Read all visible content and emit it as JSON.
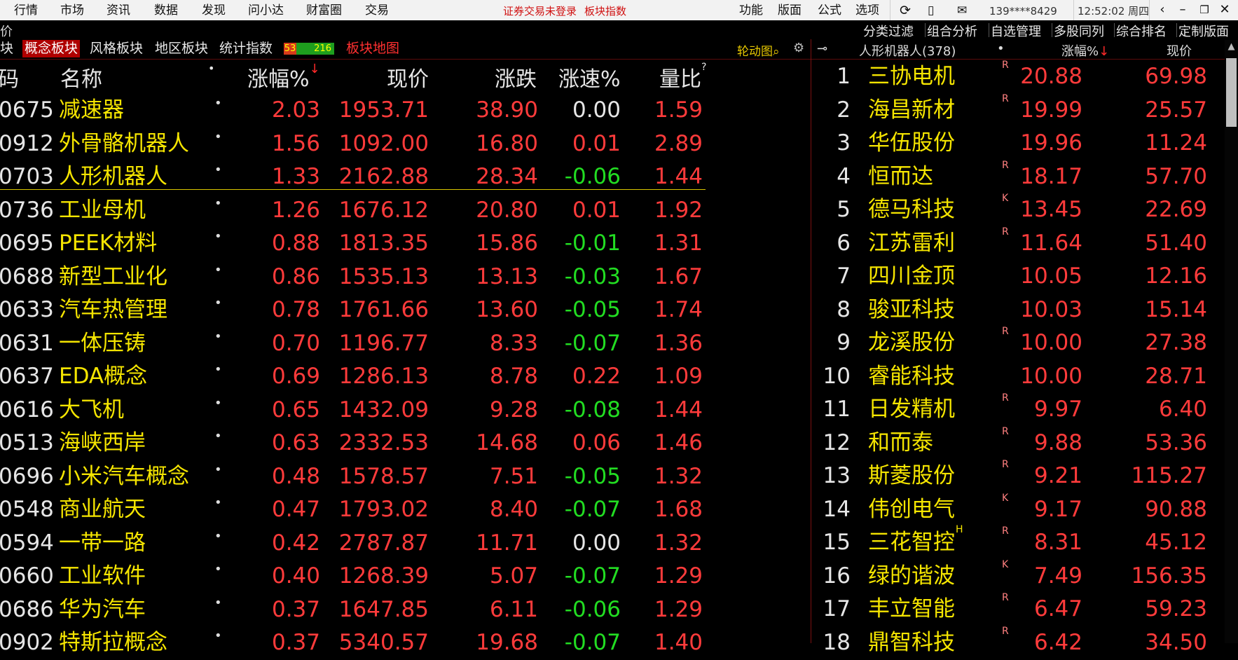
{
  "menu": {
    "items": [
      "行情",
      "市场",
      "资讯",
      "数据",
      "发现",
      "问小达",
      "财富圈",
      "交易"
    ],
    "notice_login": "证券交易未登录",
    "notice_index": "板块指数",
    "right_items": [
      "功能",
      "版面",
      "公式",
      "选项"
    ],
    "account": "139****8429",
    "clock": "12:52:02 周四"
  },
  "toolbar": {
    "left_label": "价",
    "tools": [
      "分类过滤",
      "组合分析",
      "自选管理",
      "多股同列",
      "综合排名",
      "定制版面"
    ]
  },
  "tabs": {
    "cut_tab": "块",
    "items": [
      "概念板块",
      "风格板块",
      "地区板块",
      "统计指数"
    ],
    "up_count": "53",
    "down_count": "216",
    "map_label": "板块地图",
    "rotate_label": "轮动图"
  },
  "right_panel": {
    "title": "人形机器人(378)",
    "dot": "•",
    "col_pct": "涨幅%",
    "col_price": "现价",
    "stocks": [
      {
        "rank": "1",
        "name": "三协电机",
        "tag": "R",
        "pct": "20.88",
        "price": "69.98"
      },
      {
        "rank": "2",
        "name": "海昌新材",
        "tag": "R",
        "pct": "19.99",
        "price": "25.57"
      },
      {
        "rank": "3",
        "name": "华伍股份",
        "tag": "",
        "pct": "19.96",
        "price": "11.24"
      },
      {
        "rank": "4",
        "name": "恒而达",
        "tag": "R",
        "pct": "18.17",
        "price": "57.70"
      },
      {
        "rank": "5",
        "name": "德马科技",
        "tag": "K",
        "pct": "13.45",
        "price": "22.69"
      },
      {
        "rank": "6",
        "name": "江苏雷利",
        "tag": "R",
        "pct": "11.64",
        "price": "51.40"
      },
      {
        "rank": "7",
        "name": "四川金顶",
        "tag": "",
        "pct": "10.05",
        "price": "12.16"
      },
      {
        "rank": "8",
        "name": "骏亚科技",
        "tag": "",
        "pct": "10.03",
        "price": "15.14"
      },
      {
        "rank": "9",
        "name": "龙溪股份",
        "tag": "R",
        "pct": "10.00",
        "price": "27.38"
      },
      {
        "rank": "10",
        "name": "睿能科技",
        "tag": "",
        "pct": "10.00",
        "price": "28.71"
      },
      {
        "rank": "11",
        "name": "日发精机",
        "tag": "R",
        "pct": "9.97",
        "price": "6.40"
      },
      {
        "rank": "12",
        "name": "和而泰",
        "tag": "R",
        "pct": "9.88",
        "price": "53.36"
      },
      {
        "rank": "13",
        "name": "斯菱股份",
        "tag": "R",
        "pct": "9.21",
        "price": "115.27"
      },
      {
        "rank": "14",
        "name": "伟创电气",
        "tag": "K",
        "pct": "9.17",
        "price": "90.88"
      },
      {
        "rank": "15",
        "name": "三花智控",
        "tag": "R",
        "pct": "8.31",
        "price": "45.12",
        "sup": "H"
      },
      {
        "rank": "16",
        "name": "绿的谐波",
        "tag": "K",
        "pct": "7.49",
        "price": "156.35"
      },
      {
        "rank": "17",
        "name": "丰立智能",
        "tag": "R",
        "pct": "6.47",
        "price": "59.23"
      },
      {
        "rank": "18",
        "name": "鼎智科技",
        "tag": "R",
        "pct": "6.42",
        "price": "34.50"
      }
    ]
  },
  "table": {
    "headers": {
      "code": "码",
      "name": "名称",
      "dot": "•",
      "pct": "涨幅%",
      "price": "现价",
      "change": "涨跌",
      "speed": "涨速%",
      "vol_ratio": "量比",
      "vol_sup": "?"
    },
    "rows": [
      {
        "code": "0675",
        "name": "减速器",
        "pct": "2.03",
        "price": "1953.71",
        "change": "38.90",
        "speed": "0.00",
        "speed_dir": "flat",
        "vr": "1.59"
      },
      {
        "code": "0912",
        "name": "外骨骼机器人",
        "pct": "1.56",
        "price": "1092.00",
        "change": "16.80",
        "speed": "0.01",
        "speed_dir": "up",
        "vr": "2.89"
      },
      {
        "code": "0703",
        "name": "人形机器人",
        "pct": "1.33",
        "price": "2162.88",
        "change": "28.34",
        "speed": "-0.06",
        "speed_dir": "down",
        "vr": "1.44"
      },
      {
        "code": "0736",
        "name": "工业母机",
        "pct": "1.26",
        "price": "1676.12",
        "change": "20.80",
        "speed": "0.01",
        "speed_dir": "up",
        "vr": "1.92"
      },
      {
        "code": "0695",
        "name": "PEEK材料",
        "pct": "0.88",
        "price": "1813.35",
        "change": "15.86",
        "speed": "-0.01",
        "speed_dir": "down",
        "vr": "1.31"
      },
      {
        "code": "0688",
        "name": "新型工业化",
        "pct": "0.86",
        "price": "1535.13",
        "change": "13.13",
        "speed": "-0.03",
        "speed_dir": "down",
        "vr": "1.67"
      },
      {
        "code": "0633",
        "name": "汽车热管理",
        "pct": "0.78",
        "price": "1761.66",
        "change": "13.60",
        "speed": "-0.05",
        "speed_dir": "down",
        "vr": "1.74"
      },
      {
        "code": "0631",
        "name": "一体压铸",
        "pct": "0.70",
        "price": "1196.77",
        "change": "8.33",
        "speed": "-0.07",
        "speed_dir": "down",
        "vr": "1.36"
      },
      {
        "code": "0637",
        "name": "EDA概念",
        "pct": "0.69",
        "price": "1286.13",
        "change": "8.78",
        "speed": "0.22",
        "speed_dir": "up",
        "vr": "1.09"
      },
      {
        "code": "0616",
        "name": "大飞机",
        "pct": "0.65",
        "price": "1432.09",
        "change": "9.28",
        "speed": "-0.08",
        "speed_dir": "down",
        "vr": "1.44"
      },
      {
        "code": "0513",
        "name": "海峡西岸",
        "pct": "0.63",
        "price": "2332.53",
        "change": "14.68",
        "speed": "0.06",
        "speed_dir": "up",
        "vr": "1.46"
      },
      {
        "code": "0696",
        "name": "小米汽车概念",
        "pct": "0.48",
        "price": "1578.57",
        "change": "7.51",
        "speed": "-0.05",
        "speed_dir": "down",
        "vr": "1.32"
      },
      {
        "code": "0548",
        "name": "商业航天",
        "pct": "0.47",
        "price": "1793.02",
        "change": "8.40",
        "speed": "-0.07",
        "speed_dir": "down",
        "vr": "1.68"
      },
      {
        "code": "0594",
        "name": "一带一路",
        "pct": "0.42",
        "price": "2787.87",
        "change": "11.71",
        "speed": "0.00",
        "speed_dir": "flat",
        "vr": "1.32"
      },
      {
        "code": "0660",
        "name": "工业软件",
        "pct": "0.40",
        "price": "1268.39",
        "change": "5.07",
        "speed": "-0.07",
        "speed_dir": "down",
        "vr": "1.29"
      },
      {
        "code": "0686",
        "name": "华为汽车",
        "pct": "0.37",
        "price": "1647.85",
        "change": "6.11",
        "speed": "-0.06",
        "speed_dir": "down",
        "vr": "1.29"
      },
      {
        "code": "0902",
        "name": "特斯拉概念",
        "pct": "0.37",
        "price": "5340.57",
        "change": "19.68",
        "speed": "-0.07",
        "speed_dir": "down",
        "vr": "1.40"
      }
    ]
  },
  "colors": {
    "up": "#ff3b3b",
    "down": "#22dd22",
    "flat": "#e6e6e6",
    "name": "#f5e500",
    "active_tab": "#b00000"
  },
  "icons": [
    "refresh-icon",
    "phone-icon",
    "mail-icon",
    "back-icon",
    "minimize-icon",
    "restore-icon",
    "close-icon",
    "search-icon",
    "gear-icon",
    "pin-icon",
    "sort-down-icon"
  ]
}
